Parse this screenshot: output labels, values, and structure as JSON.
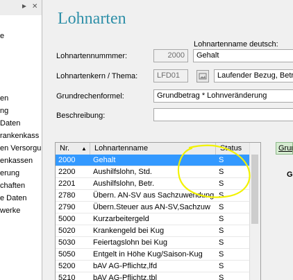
{
  "nav": {
    "items": [
      "e",
      "en",
      "ng",
      "Daten",
      "rankenkass",
      "en Versorgu",
      "enkassen",
      "erung",
      "chaften",
      "e Daten",
      "werke"
    ]
  },
  "form": {
    "title": "Lohnarten",
    "lohnartenname_label": "Lohnartenname deutsch:",
    "lohnartenname_value": "Gehalt",
    "nummer_label": "Lohnartennummmer:",
    "nummer_value": "2000",
    "kern_label": "Lohnartenkern / Thema:",
    "kern_value": "LFD01",
    "thema_value": "Laufender Bezug, Betr",
    "formel_label": "Grundrechenformel:",
    "formel_value": "Grundbetrag * Lohnveränderung",
    "beschreibung_label": "Beschreibung:",
    "beschreibung_value": ""
  },
  "grid": {
    "columns": {
      "nr": "Nr.",
      "name": "Lohnartenname",
      "status": "Status"
    },
    "rows": [
      {
        "nr": "2000",
        "name": "Gehalt",
        "status": "S"
      },
      {
        "nr": "2200",
        "name": "Aushilfslohn, Std.",
        "status": "S"
      },
      {
        "nr": "2201",
        "name": "Aushilfslohn, Betr.",
        "status": "S"
      },
      {
        "nr": "2780",
        "name": "Übern. AN-SV aus Sachzuwendung",
        "status": "S"
      },
      {
        "nr": "2790",
        "name": "Übern.Steuer aus AN-SV,Sachzuw",
        "status": "S"
      },
      {
        "nr": "5000",
        "name": "Kurzarbeitergeld",
        "status": "S"
      },
      {
        "nr": "5020",
        "name": "Krankengeld bei Kug",
        "status": "S"
      },
      {
        "nr": "5030",
        "name": "Feiertagslohn bei Kug",
        "status": "S"
      },
      {
        "nr": "5050",
        "name": "Entgelt in Höhe Kug/Saison-Kug",
        "status": "S"
      },
      {
        "nr": "5200",
        "name": "bAV AG-Pflichtz,lfd",
        "status": "S"
      },
      {
        "nr": "5210",
        "name": "bAV AG-Pflichtz,tbl",
        "status": "S"
      }
    ]
  },
  "right": {
    "tab_label": "Grund",
    "fragment": "G"
  },
  "colors": {
    "title": "#2e8fa8",
    "selection": "#3399ff",
    "annotation": "#f2f200"
  }
}
